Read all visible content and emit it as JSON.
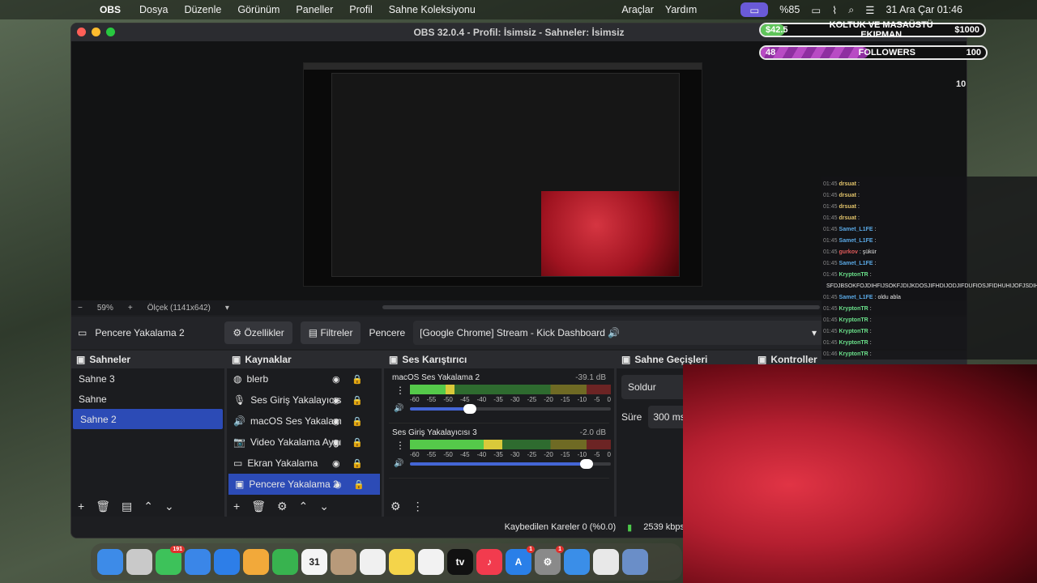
{
  "menubar": {
    "app": "OBS",
    "items": [
      "Dosya",
      "Düzenle",
      "Görünüm",
      "Paneller",
      "Profil",
      "Sahne Koleksiyonu"
    ],
    "right_items": [
      "Araçlar",
      "Yardım"
    ],
    "battery": "%85",
    "datetime": "31 Ara Çar  01:46"
  },
  "window": {
    "title": "OBS 32.0.4 - Profil: İsimsiz - Sahneler: İsimsiz"
  },
  "widgets": {
    "donation": {
      "current": "$42.5",
      "label": "KOLTUK VE MASAÜSTÜ EKIPMAN",
      "goal": "$1000",
      "progress": 0.0425
    },
    "followers": {
      "current": "48",
      "label": "FOLLOWERS",
      "goal": "100",
      "progress": 0.48
    },
    "side_number": "10"
  },
  "preview": {
    "zoom": "59%",
    "scale": "Ölçek (1141x642)"
  },
  "source_bar": {
    "selected_source": "Pencere Yakalama 2",
    "properties": "Özellikler",
    "filters": "Filtreler",
    "window_label": "Pencere",
    "window_value": "[Google Chrome] Stream - Kick Dashboard 🔊"
  },
  "scenes": {
    "title": "Sahneler",
    "items": [
      {
        "label": "Sahne 3"
      },
      {
        "label": "Sahne"
      },
      {
        "label": "Sahne 2",
        "selected": true
      }
    ]
  },
  "sources": {
    "title": "Kaynaklar",
    "items": [
      {
        "label": "blerb",
        "icon": "globe-icon"
      },
      {
        "label": "Ses Giriş Yakalayıcısı",
        "icon": "microphone-icon"
      },
      {
        "label": "macOS Ses Yakalama",
        "icon": "speaker-icon"
      },
      {
        "label": "Video Yakalama Aygı",
        "icon": "camera-icon"
      },
      {
        "label": "Ekran Yakalama",
        "icon": "monitor-icon"
      },
      {
        "label": "Pencere Yakalama 2",
        "icon": "window-icon",
        "selected": true
      }
    ]
  },
  "mixer": {
    "title": "Ses Karıştırıcı",
    "scale": [
      "-60",
      "-55",
      "-50",
      "-45",
      "-40",
      "-35",
      "-30",
      "-25",
      "-20",
      "-15",
      "-10",
      "-5",
      "0"
    ],
    "channels": [
      {
        "name": "macOS Ses Yakalama 2",
        "db": "-39.1 dB",
        "level": 0.22,
        "volume": 0.3
      },
      {
        "name": "Ses Giriş Yakalayıcısı 3",
        "db": "-2.0 dB",
        "level": 0.46,
        "volume": 0.88
      }
    ]
  },
  "transitions": {
    "title": "Sahne Geçişleri",
    "type": "Soldur",
    "duration_label": "Süre",
    "duration": "300 ms"
  },
  "controls": {
    "title": "Kontroller"
  },
  "status": {
    "dropped": "Kaybedilen Kareler 0 (%0.0)",
    "bitrate": "2539 kbps"
  },
  "chat": [
    {
      "time": "01:45",
      "user": "drsuat",
      "msg": ":",
      "color": "#e0c26a"
    },
    {
      "time": "01:45",
      "user": "drsuat",
      "msg": ":",
      "color": "#e0c26a"
    },
    {
      "time": "01:45",
      "user": "drsuat",
      "msg": ":",
      "color": "#e0c26a"
    },
    {
      "time": "01:45",
      "user": "drsuat",
      "msg": ":",
      "color": "#e0c26a"
    },
    {
      "time": "01:45",
      "user": "Samet_L1FE",
      "msg": ":",
      "color": "#5aa9e6"
    },
    {
      "time": "01:45",
      "user": "Samet_L1FE",
      "msg": ":",
      "color": "#5aa9e6"
    },
    {
      "time": "01:45",
      "user": "gurkov",
      "msg": ": şükür",
      "color": "#e05a5a"
    },
    {
      "time": "01:45",
      "user": "Samet_L1FE",
      "msg": ":",
      "color": "#5aa9e6"
    },
    {
      "time": "01:45",
      "user": "KryptonTR",
      "msg": ":",
      "color": "#6ae08a"
    },
    {
      "time": "",
      "user": "",
      "msg": "SFDJBSOKFOJDIHFIJSOKFJDIJKDOSJIFHDIJODJIFDUFIOSJFIDHUHIJOFJSDIH",
      "color": "#fff"
    },
    {
      "time": "01:45",
      "user": "Samet_L1FE",
      "msg": ": oldu abla",
      "color": "#5aa9e6"
    },
    {
      "time": "01:45",
      "user": "KryptonTR",
      "msg": ":",
      "color": "#6ae08a"
    },
    {
      "time": "01:45",
      "user": "KryptonTR",
      "msg": ":",
      "color": "#6ae08a"
    },
    {
      "time": "01:45",
      "user": "KryptonTR",
      "msg": ":",
      "color": "#6ae08a"
    },
    {
      "time": "01:45",
      "user": "KryptonTR",
      "msg": ":",
      "color": "#6ae08a"
    },
    {
      "time": "01:46",
      "user": "KryptonTR",
      "msg": ":",
      "color": "#6ae08a"
    }
  ],
  "dock": {
    "apps": [
      {
        "name": "finder-icon",
        "color": "#3d8be8",
        "label": ""
      },
      {
        "name": "launchpad-icon",
        "color": "#c9c9c9",
        "label": ""
      },
      {
        "name": "messages-icon",
        "color": "#3dc25a",
        "label": "",
        "badge": "191"
      },
      {
        "name": "mail-icon",
        "color": "#3a86e8",
        "label": ""
      },
      {
        "name": "appstore-alt-icon",
        "color": "#2d7ee8",
        "label": ""
      },
      {
        "name": "photos-icon",
        "color": "#f2a93a",
        "label": ""
      },
      {
        "name": "facetime-icon",
        "color": "#38b34f",
        "label": ""
      },
      {
        "name": "calendar-icon",
        "color": "#f5f5f5",
        "label": "31"
      },
      {
        "name": "contacts-icon",
        "color": "#b89a7a",
        "label": ""
      },
      {
        "name": "reminders-icon",
        "color": "#f0f0f0",
        "label": ""
      },
      {
        "name": "notes-icon",
        "color": "#f4d44a",
        "label": ""
      },
      {
        "name": "freeform-icon",
        "color": "#f2f2f2",
        "label": ""
      },
      {
        "name": "tv-icon",
        "color": "#111",
        "label": "tv"
      },
      {
        "name": "music-icon",
        "color": "#f23b4e",
        "label": "♪"
      },
      {
        "name": "appstore-icon",
        "color": "#2a7fe8",
        "label": "A",
        "badge": "1"
      },
      {
        "name": "settings-icon",
        "color": "#8a8a8a",
        "label": "⚙",
        "badge": "1"
      },
      {
        "name": "safari-icon",
        "color": "#3a8ee8",
        "label": ""
      },
      {
        "name": "chrome-icon",
        "color": "#e8e8e8",
        "label": ""
      },
      {
        "name": "preview-icon",
        "color": "#6a8ec8",
        "label": ""
      }
    ]
  }
}
